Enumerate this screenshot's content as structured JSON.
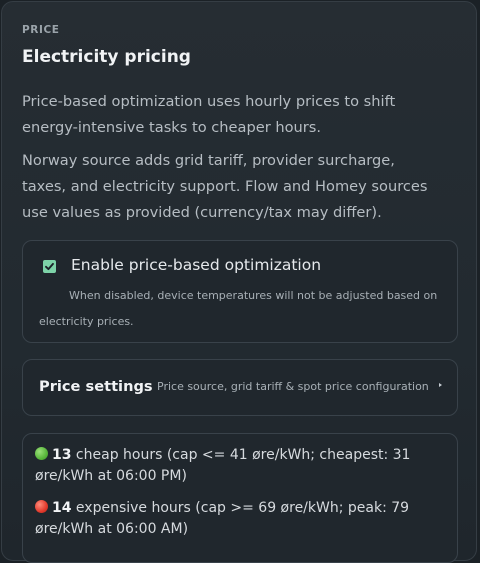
{
  "section": {
    "label": "PRICE",
    "title": "Electricity pricing",
    "description_1": "Price-based optimization uses hourly prices to shift energy-intensive tasks to cheaper hours.",
    "description_2": "Norway source adds grid tariff, provider surcharge, taxes, and electricity support. Flow and Homey sources use values as provided (currency/tax may differ)."
  },
  "toggle": {
    "checked": true,
    "label": "Enable price-based optimization",
    "hint": "When disabled, device temperatures will not be adjusted based on electricity prices."
  },
  "price_settings": {
    "title": "Price settings",
    "description": "Price source, grid tariff & spot price configuration",
    "icon": "chevron-right-icon"
  },
  "summary": {
    "cheap": {
      "icon": "green-circle-icon",
      "count": "13",
      "text": " cheap hours (cap <= 41 øre/kWh; cheapest: 31 øre/kWh at 06:00 PM)"
    },
    "expensive": {
      "icon": "red-circle-icon",
      "count": "14",
      "text": " expensive hours (cap >= 69 øre/kWh; peak: 79 øre/kWh at 06:00 AM)"
    }
  },
  "colors": {
    "accent_green": "#7dd3a8",
    "background": "#1b2126",
    "card_border": "#39424a"
  }
}
